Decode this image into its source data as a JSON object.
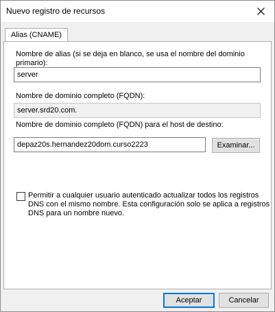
{
  "window": {
    "title": "Nuevo registro de recursos",
    "close_icon": "close-icon"
  },
  "tabs": [
    {
      "label": "Alias (CNAME)",
      "active": true
    }
  ],
  "form": {
    "alias_label_line1": "Nombre de alias (si se deja en blanco, se usa el nombre del dominio",
    "alias_label_line2": "primario):",
    "alias_value": "server",
    "fqdn_label": "Nombre de dominio completo (FQDN):",
    "fqdn_value": "server.srd20.com.",
    "target_label": "Nombre de dominio completo (FQDN) para el host de destino:",
    "target_value": "depaz20s.hernandez20dom.curso2223",
    "browse_button": "Examinar...",
    "checkbox_line1": "Permitir a cualquier usuario autenticado actualizar todos los registros",
    "checkbox_line2": "DNS con el mismo nombre. Esta configuración solo se aplica a registros",
    "checkbox_line3": "DNS para un nombre nuevo.",
    "checkbox_checked": false
  },
  "buttons": {
    "ok": "Aceptar",
    "cancel": "Cancelar"
  }
}
